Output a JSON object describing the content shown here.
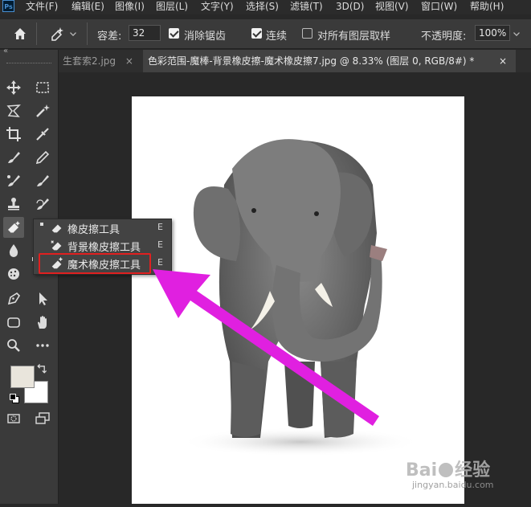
{
  "menubar": {
    "logo": "Ps",
    "items": [
      "文件(F)",
      "编辑(E)",
      "图像(I)",
      "图层(L)",
      "文字(Y)",
      "选择(S)",
      "滤镜(T)",
      "3D(D)",
      "视图(V)",
      "窗口(W)",
      "帮助(H)"
    ]
  },
  "options": {
    "tolerance_label": "容差:",
    "tolerance_value": "32",
    "antialias_label": "消除锯齿",
    "antialias_checked": true,
    "contiguous_label": "连续",
    "contiguous_checked": true,
    "sample_all_label": "对所有图层取样",
    "sample_all_checked": false,
    "opacity_label": "不透明度:",
    "opacity_value": "100%"
  },
  "tabs": [
    {
      "label": "生套索2.jpg",
      "close": "×",
      "active": false
    },
    {
      "label": "色彩范围-魔棒-背景橡皮擦-魔术橡皮擦7.jpg @ 8.33% (图层 0, RGB/8#) *",
      "close": "×",
      "active": true
    }
  ],
  "panel_collapse": "«",
  "flyout": {
    "items": [
      {
        "label": "橡皮擦工具",
        "key": "E",
        "icon": "eraser-icon"
      },
      {
        "label": "背景橡皮擦工具",
        "key": "E",
        "icon": "background-eraser-icon"
      },
      {
        "label": "魔术橡皮擦工具",
        "key": "E",
        "icon": "magic-eraser-icon"
      }
    ]
  },
  "colors": {
    "foreground": "#e9e5dc",
    "background": "#ffffff",
    "annotation_arrow": "#e020e0",
    "highlight_box": "#e02020"
  },
  "watermark": {
    "brand": "Bai",
    "brand_suffix": "经验",
    "url": "jingyan.baidu.com"
  }
}
